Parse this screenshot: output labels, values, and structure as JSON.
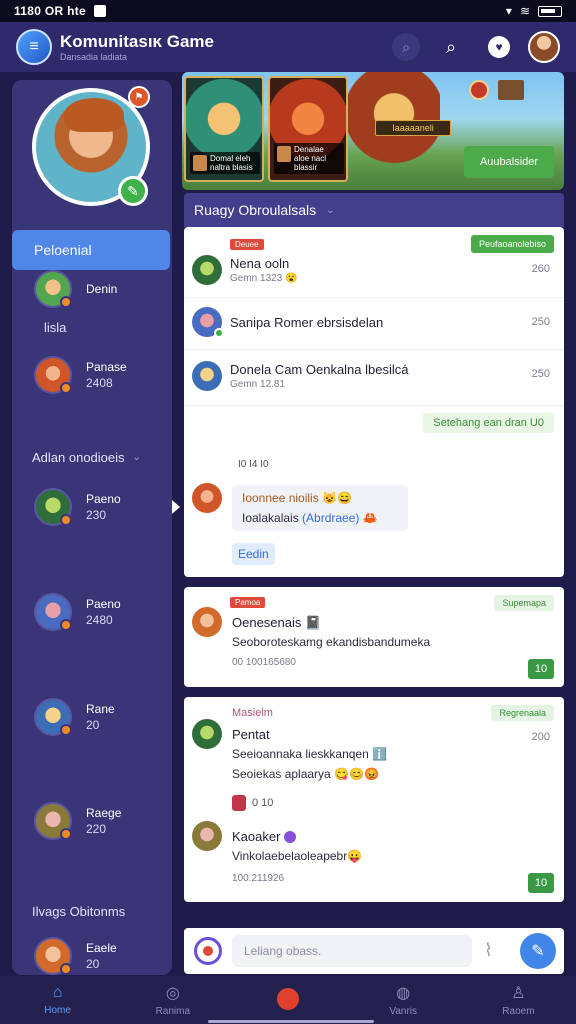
{
  "status_bar": {
    "time": "1180 OR hte"
  },
  "header": {
    "title": "Komunitasıĸ Game",
    "subtitle": "Dansadia ladiata"
  },
  "sidebar": {
    "active_item": "Peloenial",
    "rows_top": [
      {
        "name": "Denin",
        "sub": ""
      },
      {
        "name": "Panase",
        "sub": "2408"
      }
    ],
    "label_lisa": "lisla",
    "section1_label": "Adlan onodioeis",
    "rows_section": [
      {
        "name": "Paeno",
        "sub": "230"
      },
      {
        "name": "Paeno",
        "sub": "2480"
      },
      {
        "name": "Rane",
        "sub": "20"
      },
      {
        "name": "Raege",
        "sub": "220"
      }
    ],
    "section2_label": "Ilvags Obitonms",
    "last_row": {
      "name": "Eaele",
      "sub": "20"
    }
  },
  "banner": {
    "card1_label": "Domal eleh naltra blasis",
    "card2_label": "Denalae aloe nacl blassir",
    "tag": "Iaaaaaneli",
    "cta": "Auubalsider"
  },
  "panel1": {
    "heading": "Ruagy Obroulalsals",
    "badge_red": "Deuee",
    "badge_green": "Peufaoanolebiso",
    "rows": [
      {
        "name": "Nena ooln",
        "sub": "Gemn 1323 😮",
        "time": "260"
      },
      {
        "name": "Sanipa Romer ebrsisdelan",
        "sub": "",
        "time": "250"
      },
      {
        "name": "Donela Cam Oenkalna lbesilcá",
        "sub": "Gemn 12.81",
        "time": "250"
      }
    ],
    "pill": "Setehang ean dran U0",
    "note": "I0 I4 I0",
    "bubble_l1": "Ioonnee nioilis 😺😄",
    "bubble_l2_a": "Ioalakalais",
    "bubble_l2_link": "(Abrdraee)",
    "bubble_l2_b": "🦀",
    "reply": "Eedin"
  },
  "panel2": {
    "badge_red": "Pamoa",
    "badge_green": "Supemapa",
    "title": "Oenesenais 📓",
    "body": "Seoboroteskamg ekandisbandumeka",
    "meta": "00 100165680",
    "count": "10"
  },
  "panel3": {
    "label_pink": "Masielm",
    "badge_green": "Regrenaala",
    "time": "200",
    "title": "Pentat",
    "line1": "Seeioannaka lieskkanqen ℹ️",
    "line2": "Seoiekas aplaarya 😋😊😡",
    "chip_text": "0 10",
    "name2": "Kaoaker",
    "body2": "Vinkolaebelaoleapebr😛",
    "meta2": "100.211926",
    "count": "10"
  },
  "composer": {
    "placeholder": "Leliang obass."
  },
  "bottom_nav": [
    {
      "label": "Home"
    },
    {
      "label": "Ranima"
    },
    {
      "label": ""
    },
    {
      "label": "Vanris"
    },
    {
      "label": "Raoem"
    }
  ]
}
